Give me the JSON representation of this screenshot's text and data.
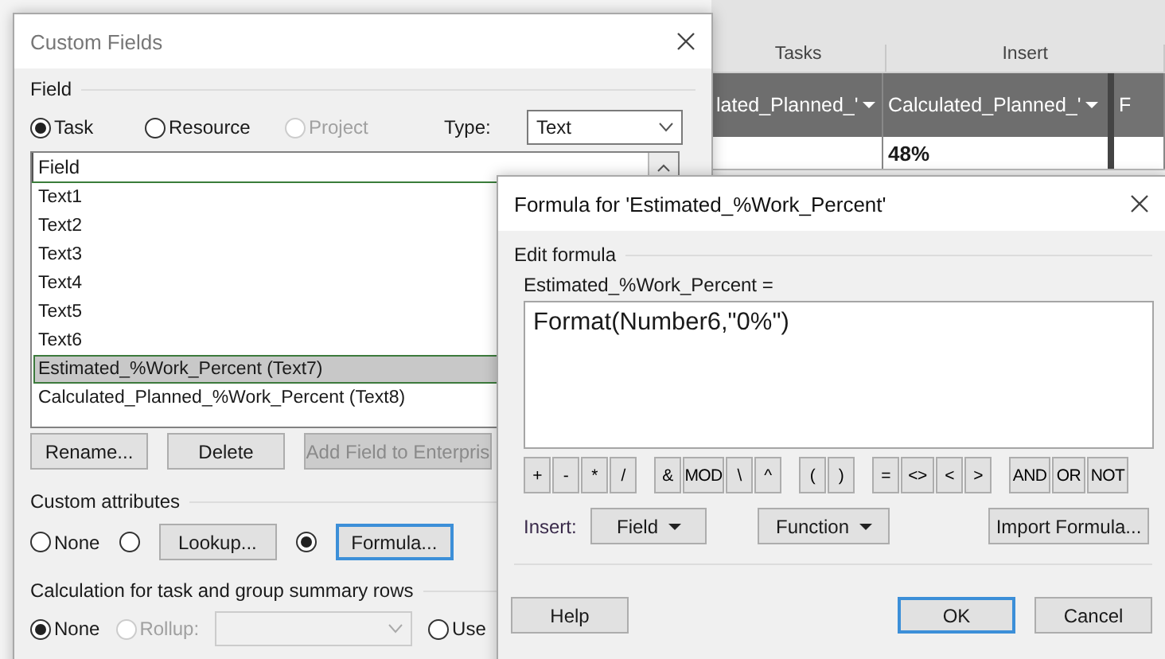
{
  "background_app": {
    "ribbon_groups": [
      "Tasks",
      "Insert"
    ],
    "columns": [
      {
        "label": "lated_Planned_'",
        "dropdown": true
      },
      {
        "label": "Calculated_Planned_'",
        "dropdown": true
      },
      {
        "label": "F",
        "dropdown": false
      }
    ],
    "cells": [
      "",
      "48%",
      ""
    ]
  },
  "custom_fields": {
    "title": "Custom Fields",
    "field_section": "Field",
    "scope": [
      {
        "label": "Task",
        "selected": true,
        "disabled": false
      },
      {
        "label": "Resource",
        "selected": false,
        "disabled": false
      },
      {
        "label": "Project",
        "selected": false,
        "disabled": true
      }
    ],
    "type_label": "Type:",
    "type_value": "Text",
    "list_header": "Field",
    "items": [
      {
        "label": "Text1",
        "selected": false
      },
      {
        "label": "Text2",
        "selected": false
      },
      {
        "label": "Text3",
        "selected": false
      },
      {
        "label": "Text4",
        "selected": false
      },
      {
        "label": "Text5",
        "selected": false
      },
      {
        "label": "Text6",
        "selected": false
      },
      {
        "label": "Estimated_%Work_Percent (Text7)",
        "selected": true
      },
      {
        "label": "Calculated_Planned_%Work_Percent (Text8)",
        "selected": false
      }
    ],
    "buttons": [
      {
        "label": "Rename...",
        "disabled": false
      },
      {
        "label": "Delete",
        "disabled": false
      },
      {
        "label": "Add Field to Enterpris",
        "disabled": true
      }
    ],
    "custom_attributes": {
      "label": "Custom attributes",
      "options": [
        {
          "kind": "radio",
          "label": "None",
          "selected": false
        },
        {
          "kind": "radio",
          "selected": false
        },
        {
          "kind": "button",
          "label": "Lookup...",
          "focused": false
        },
        {
          "kind": "radio",
          "selected": true
        },
        {
          "kind": "button",
          "label": "Formula...",
          "focused": true
        }
      ]
    },
    "calculation": {
      "label": "Calculation for task and group summary rows",
      "options": [
        {
          "kind": "radio",
          "label": "None",
          "selected": true,
          "disabled": false
        },
        {
          "kind": "radio",
          "label": "Rollup:",
          "selected": false,
          "disabled": true
        },
        {
          "kind": "select",
          "disabled": true
        },
        {
          "kind": "radio",
          "label": "Use",
          "selected": false,
          "disabled": false
        }
      ]
    }
  },
  "formula_dialog": {
    "title": "Formula for 'Estimated_%Work_Percent'",
    "section": "Edit formula",
    "field_label": "Estimated_%Work_Percent =",
    "formula": "Format(Number6,\"0%\")",
    "operator_groups": [
      [
        "+",
        "-",
        "*",
        "/"
      ],
      [
        "&",
        "MOD",
        "\\",
        "^"
      ],
      [
        "(",
        ")"
      ],
      [
        "=",
        "<>",
        "<",
        ">"
      ],
      [
        "AND",
        "OR",
        "NOT"
      ]
    ],
    "insert_label": "Insert:",
    "insert_buttons": [
      {
        "label": "Field",
        "menu": true
      },
      {
        "label": "Function",
        "menu": true
      },
      {
        "label": "Import Formula...",
        "menu": false
      }
    ],
    "footer_buttons": [
      {
        "label": "Help",
        "focused": false
      },
      {
        "label": "OK",
        "focused": true
      },
      {
        "label": "Cancel",
        "focused": false
      }
    ]
  }
}
